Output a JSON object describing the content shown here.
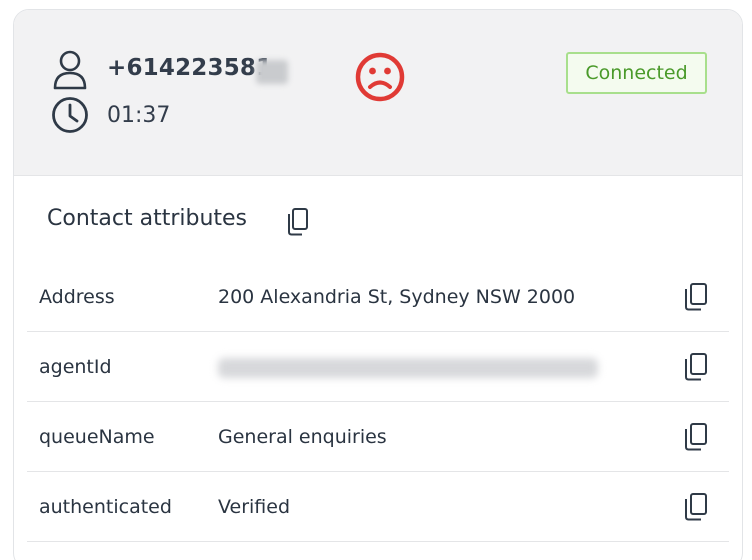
{
  "contact": {
    "phone": "+614223581",
    "duration": "01:37",
    "status": "Connected",
    "sentiment": "negative",
    "icons": {
      "caller": "user-icon",
      "duration": "clock-icon",
      "sentiment": "frown-icon",
      "copy": "copy-icon"
    }
  },
  "attributes": {
    "title": "Contact attributes",
    "rows": [
      {
        "key": "Address",
        "value": "200 Alexandria St, Sydney NSW 2000"
      },
      {
        "key": "agentId",
        "value": ""
      },
      {
        "key": "queueName",
        "value": "General enquiries"
      },
      {
        "key": "authenticated",
        "value": "Verified"
      }
    ]
  },
  "colors": {
    "status_text": "#4a9a2a",
    "status_border": "#a8df8c",
    "sentiment": "#e03a35",
    "header_bg": "#f2f2f3"
  }
}
